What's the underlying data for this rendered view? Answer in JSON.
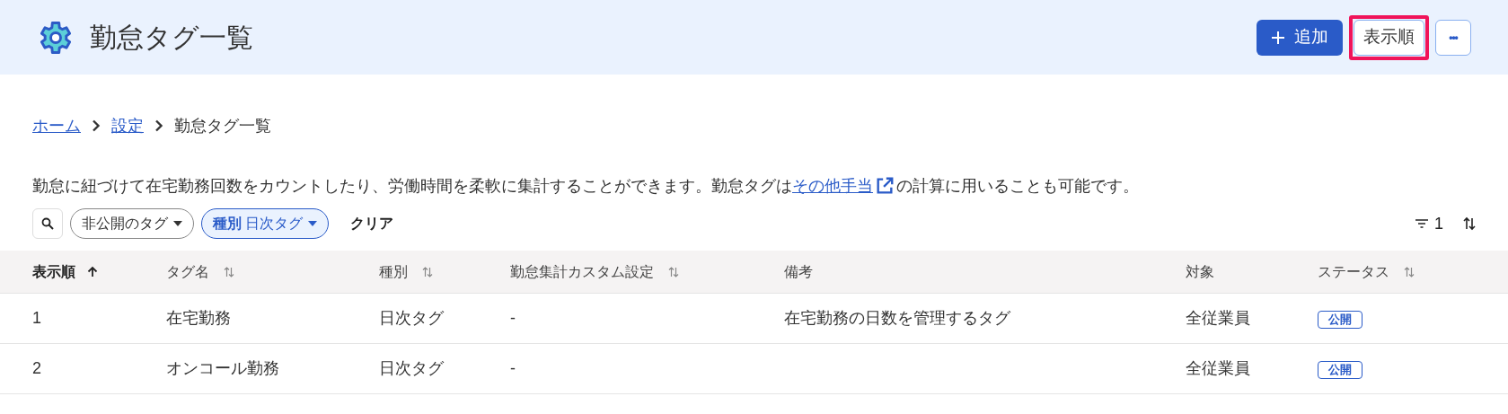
{
  "header": {
    "title": "勤怠タグ一覧",
    "actions": [
      {
        "kind": "primary",
        "label": "追加",
        "highlighted": false
      },
      {
        "kind": "outline",
        "label": "表示順",
        "highlighted": true
      },
      {
        "kind": "more",
        "label": "•••",
        "highlighted": false
      }
    ]
  },
  "breadcrumb": [
    {
      "label": "ホーム",
      "link": true
    },
    {
      "label": "設定",
      "link": true
    },
    {
      "label": "勤怠タグ一覧",
      "link": false
    }
  ],
  "description": {
    "before": "勤怠に紐づけて在宅勤務回数をカウントしたり、労働時間を柔軟に集計することができます。勤怠タグは",
    "link": "その他手当",
    "after": "の計算に用いることも可能です。"
  },
  "filters": [
    {
      "label": "非公開のタグ",
      "active": false
    },
    {
      "label": "**種別** 日次タグ",
      "active": true
    }
  ],
  "clear_label": "クリア",
  "filter_count": "1",
  "table": {
    "columns": [
      {
        "label": "表示順",
        "sorted": true,
        "sortable": true
      },
      {
        "label": "タグ名",
        "sorted": false,
        "sortable": true
      },
      {
        "label": "種別",
        "sorted": false,
        "sortable": true
      },
      {
        "label": "勤怠集計カスタム設定",
        "sorted": false,
        "sortable": true
      },
      {
        "label": "備考",
        "sorted": false,
        "sortable": false
      },
      {
        "label": "対象",
        "sorted": false,
        "sortable": false
      },
      {
        "label": "ステータス",
        "sorted": false,
        "sortable": true
      }
    ],
    "rows": [
      {
        "cells": [
          "1",
          "在宅勤務",
          "日次タグ",
          "-",
          "在宅勤務の日数を管理するタグ",
          "全従業員"
        ],
        "status": "公開"
      },
      {
        "cells": [
          "2",
          "オンコール勤務",
          "日次タグ",
          "-",
          "",
          "全従業員"
        ],
        "status": "公開"
      }
    ]
  }
}
